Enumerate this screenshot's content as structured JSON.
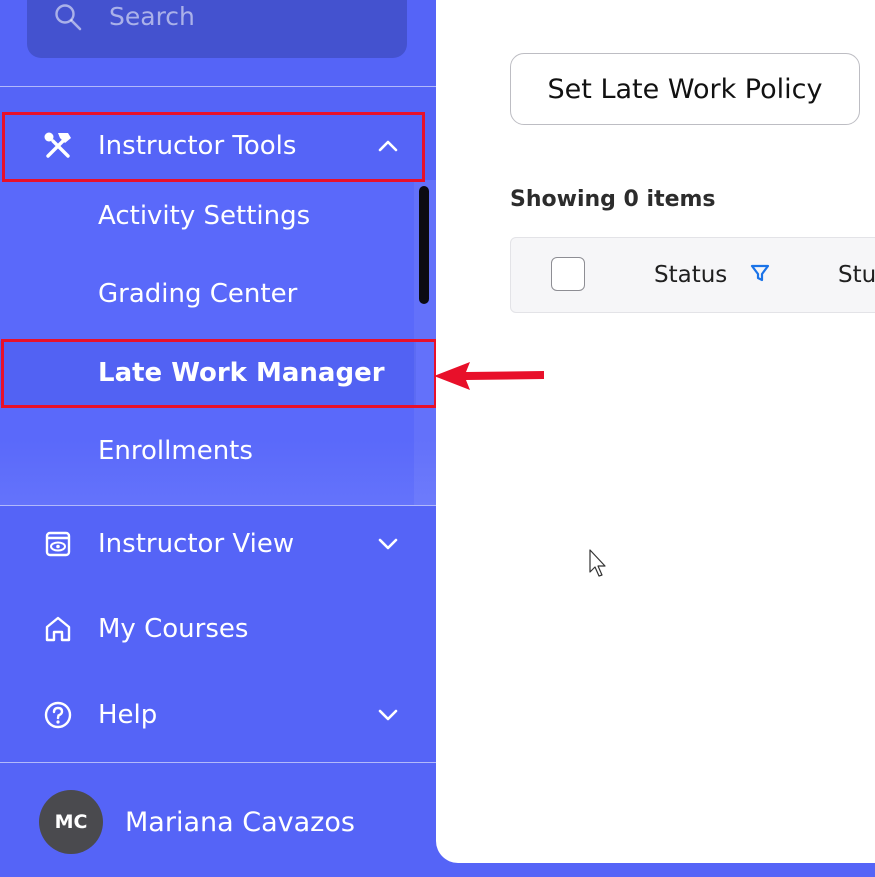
{
  "search": {
    "placeholder": "Search",
    "icon": "search-icon"
  },
  "sidebar": {
    "instructor_tools": {
      "label": "Instructor Tools",
      "icon": "tools-icon",
      "expanded": true
    },
    "submenu": [
      {
        "label": "Activity Settings"
      },
      {
        "label": "Grading Center"
      },
      {
        "label": "Late Work Manager",
        "active": true
      },
      {
        "label": "Enrollments"
      }
    ],
    "instructor_view": {
      "label": "Instructor View",
      "icon": "eye-icon"
    },
    "my_courses": {
      "label": "My Courses",
      "icon": "home-icon"
    },
    "help": {
      "label": "Help",
      "icon": "help-icon"
    }
  },
  "user": {
    "initials": "MC",
    "name": "Mariana Cavazos"
  },
  "main": {
    "policy_button": "Set Late Work Policy",
    "showing_text": "Showing 0 items",
    "columns": [
      "Status",
      "Stu"
    ]
  },
  "colors": {
    "sidebar": "#5564f7",
    "highlight": "#e8102a",
    "filter_icon": "#1a73e8",
    "avatar": "#4a4a4e"
  }
}
